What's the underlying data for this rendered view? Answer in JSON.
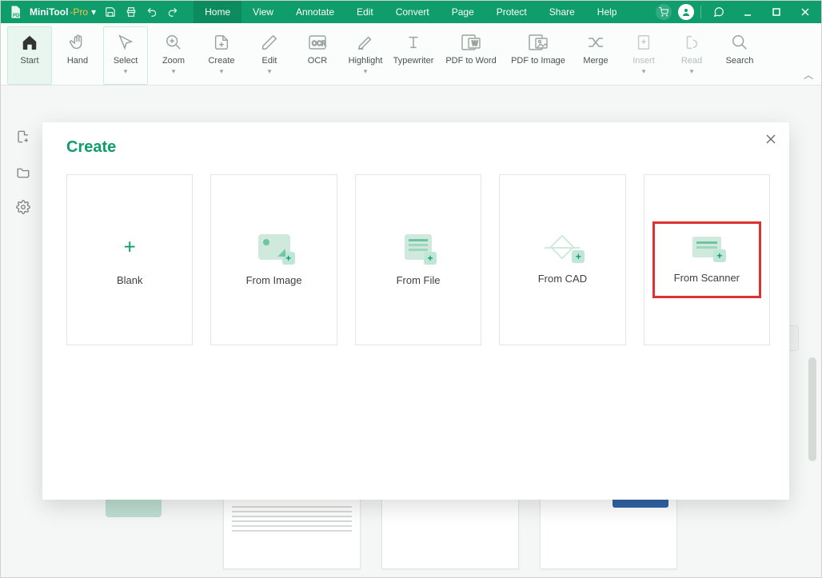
{
  "app": {
    "name": "MiniTool",
    "suffix": "-Pro"
  },
  "menu": {
    "items": [
      "Home",
      "View",
      "Annotate",
      "Edit",
      "Convert",
      "Page",
      "Protect",
      "Share",
      "Help"
    ],
    "active_index": 0
  },
  "ribbon": {
    "tools": [
      {
        "label": "Start",
        "drop": false,
        "active": true
      },
      {
        "label": "Hand",
        "drop": false
      },
      {
        "label": "Select",
        "drop": true,
        "sel": true
      },
      {
        "label": "Zoom",
        "drop": true
      },
      {
        "label": "Create",
        "drop": true
      },
      {
        "label": "Edit",
        "drop": true
      },
      {
        "label": "OCR",
        "drop": false
      },
      {
        "label": "Highlight",
        "drop": true
      },
      {
        "label": "Typewriter",
        "drop": false
      },
      {
        "label": "PDF to Word",
        "drop": false,
        "wide": true
      },
      {
        "label": "PDF to Image",
        "drop": false,
        "wide": true
      },
      {
        "label": "Merge",
        "drop": false
      },
      {
        "label": "Insert",
        "drop": true,
        "disabled": true
      },
      {
        "label": "Read",
        "drop": true,
        "disabled": true
      },
      {
        "label": "Search",
        "drop": false
      }
    ]
  },
  "modal": {
    "title": "Create",
    "options": [
      {
        "label": "Blank",
        "icon": "blank"
      },
      {
        "label": "From Image",
        "icon": "img"
      },
      {
        "label": "From File",
        "icon": "file"
      },
      {
        "label": "From CAD",
        "icon": "cad"
      },
      {
        "label": "From Scanner",
        "icon": "scan",
        "highlight": true
      }
    ]
  }
}
